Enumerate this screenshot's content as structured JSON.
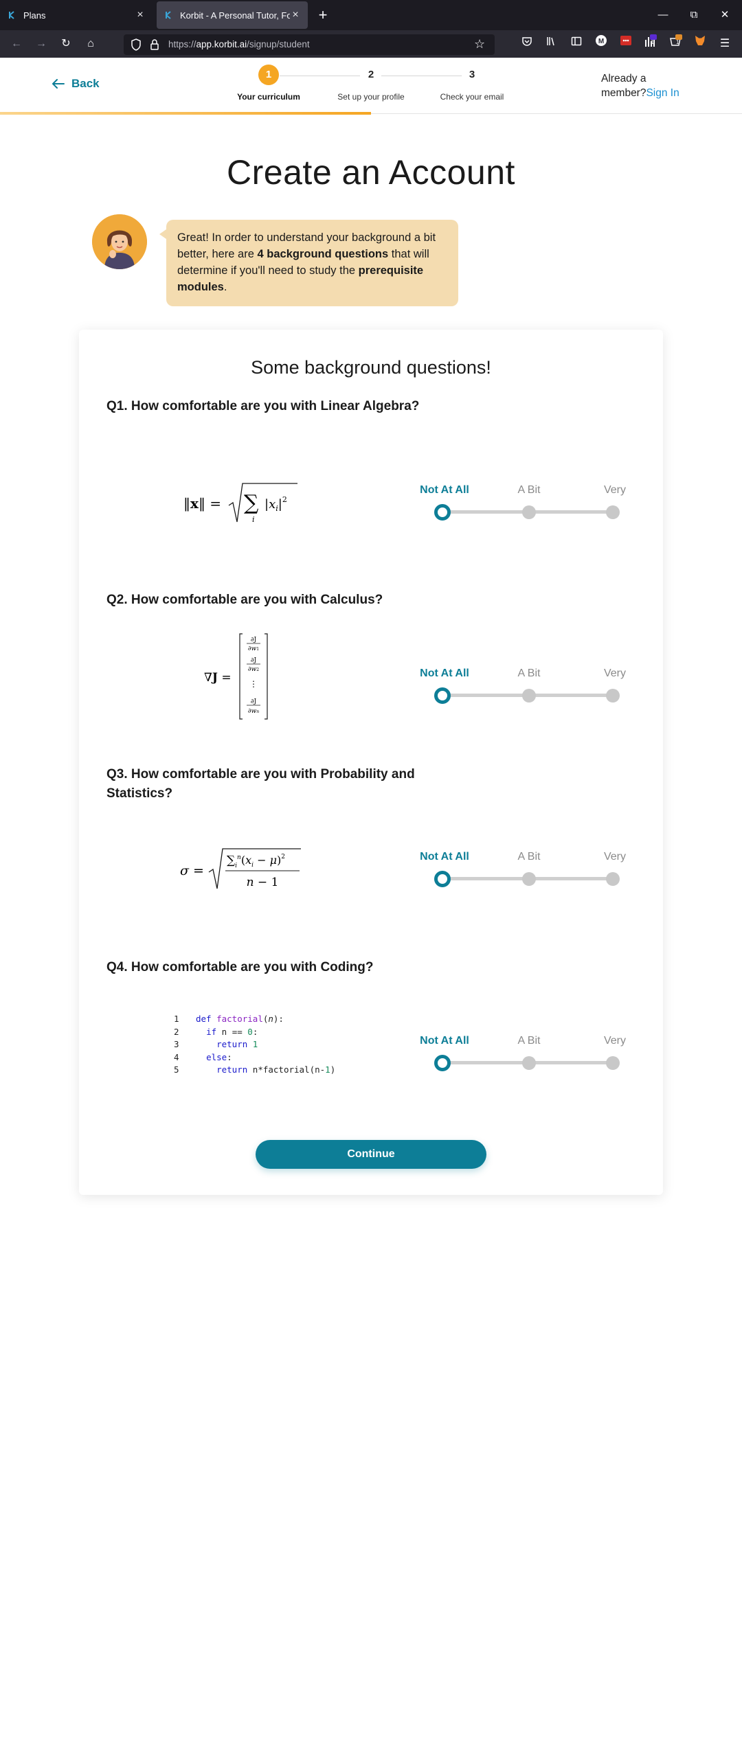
{
  "browser": {
    "tabs": [
      {
        "title": "Plans",
        "close": "×"
      },
      {
        "title": "Korbit - A Personal Tutor, For Eve",
        "close": "×"
      }
    ],
    "new_tab": "+",
    "url_host": "app.korbit.ai",
    "url_prefix": "https://",
    "url_path": "/signup/student",
    "toolbar_badges": {
      "extension_count": "1",
      "notifications": "1"
    }
  },
  "header": {
    "back_label": "Back",
    "steps": [
      {
        "number": "1",
        "label": "Your curriculum",
        "active": true
      },
      {
        "number": "2",
        "label": "Set up your profile",
        "active": false
      },
      {
        "number": "3",
        "label": "Check your email",
        "active": false
      }
    ],
    "progress_fraction": 0.5,
    "member_text": "Already a member?",
    "sign_in": "Sign In"
  },
  "page_title": "Create an Account",
  "intro": {
    "part1": "Great! In order to understand your background a bit better, here are ",
    "bold1": "4 background questions",
    "part2": " that will determine if you'll need to study the ",
    "bold2": "prerequisite modules",
    "part3": "."
  },
  "card": {
    "title": "Some background questions!",
    "slider_labels": [
      "Not At All",
      "A Bit",
      "Very"
    ],
    "questions": [
      {
        "text": "Q1. How comfortable are you with Linear Algebra?",
        "selected": "Not At All"
      },
      {
        "text": "Q2. How comfortable are you with Calculus?",
        "selected": "Not At All"
      },
      {
        "text": "Q3. How comfortable are you with Probability and Statistics?",
        "selected": "Not At All"
      },
      {
        "text": "Q4. How comfortable are you with Coding?",
        "selected": "Not At All"
      }
    ],
    "code_lines": [
      "1",
      "2",
      "3",
      "4",
      "5"
    ],
    "continue_label": "Continue"
  },
  "colors": {
    "accent": "#0d7e97",
    "step_active": "#f5a623",
    "bubble": "#f4dcb0",
    "link": "#1a8fd1"
  }
}
